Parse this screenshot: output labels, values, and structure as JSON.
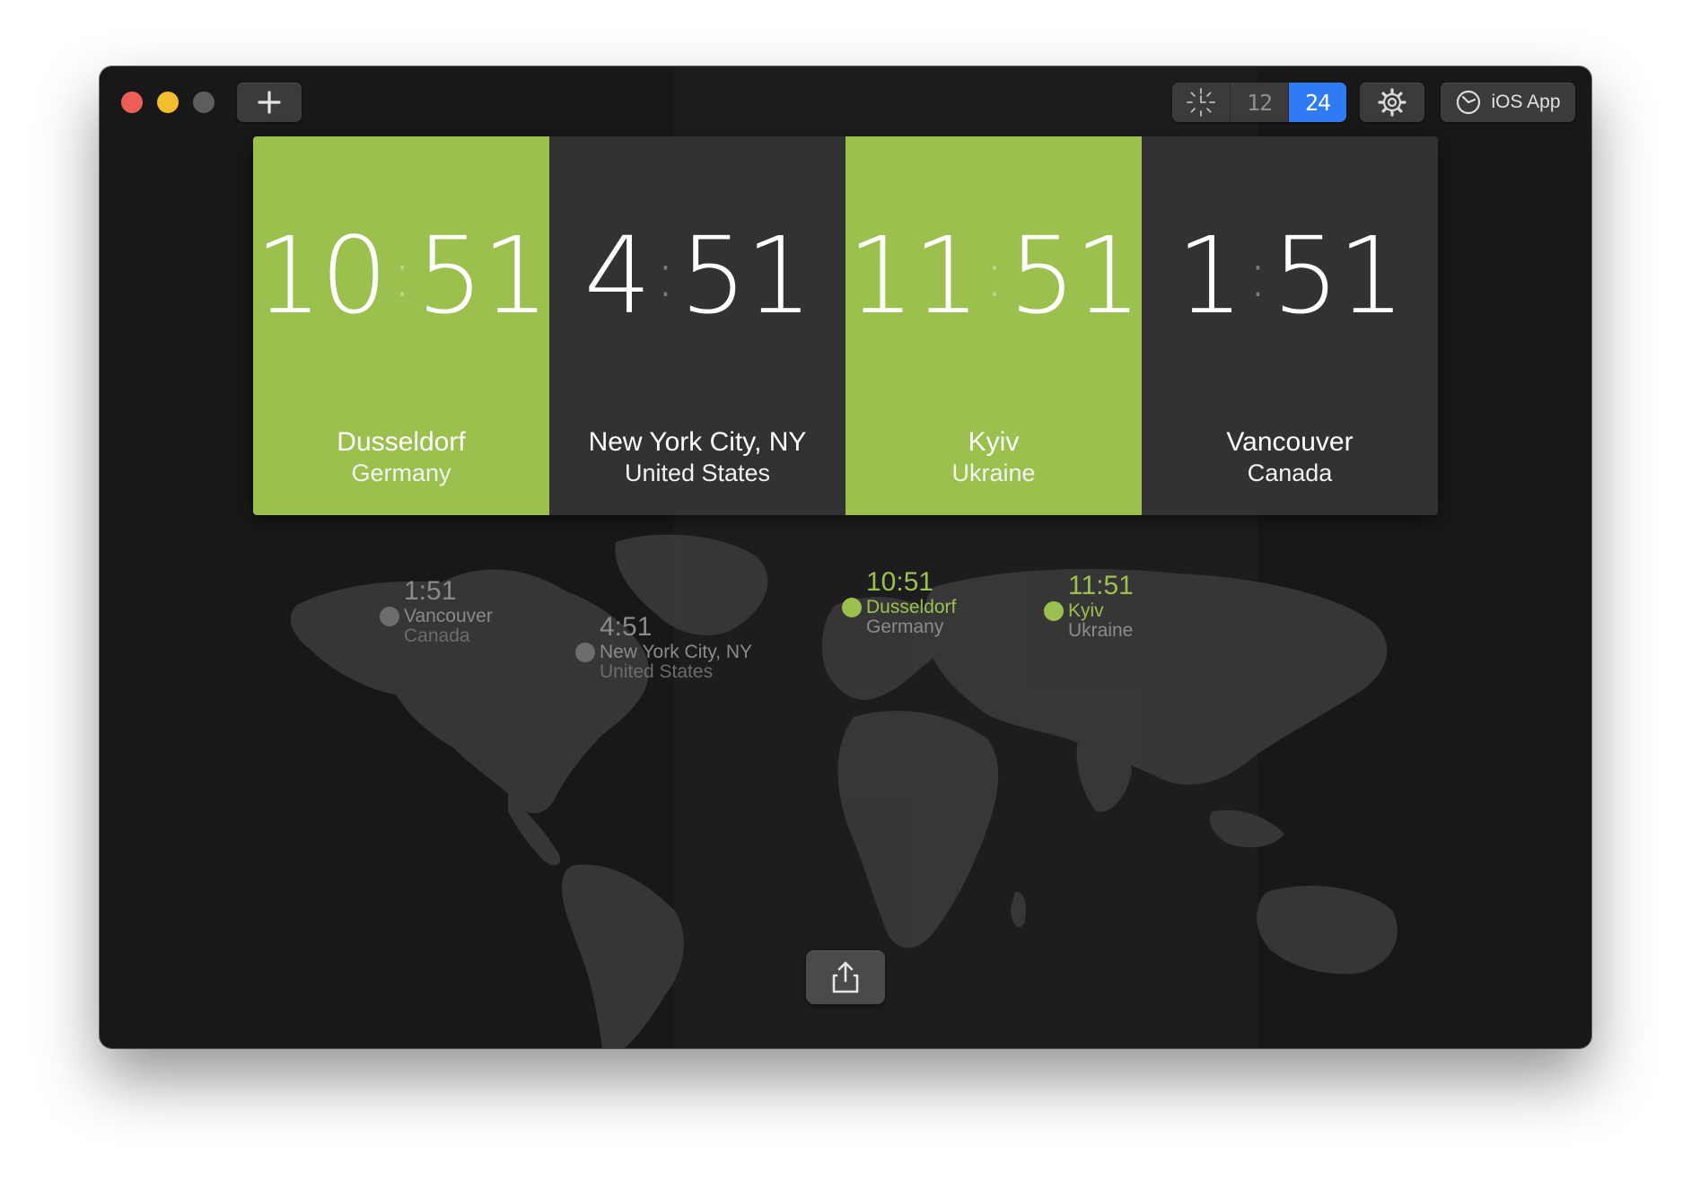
{
  "toolbar": {
    "add_icon": "plus-icon",
    "format_toggle": [
      {
        "id": "analog",
        "icon": "analog-clock-icon"
      },
      {
        "id": "12h",
        "label": "12"
      },
      {
        "id": "24h",
        "label": "24",
        "active": true
      }
    ],
    "settings_icon": "gear-icon",
    "ios_app_label": "iOS App",
    "ios_app_icon": "clock-outline-icon"
  },
  "clocks": [
    {
      "hours": "10",
      "minutes": "51",
      "city": "Dusseldorf",
      "country": "Germany",
      "color": "#9cc04e"
    },
    {
      "hours": "4",
      "minutes": "51",
      "city": "New York City, NY",
      "country": "United States",
      "color": "#323232"
    },
    {
      "hours": "11",
      "minutes": "51",
      "city": "Kyiv",
      "country": "Ukraine",
      "color": "#9cc04e"
    },
    {
      "hours": "1",
      "minutes": "51",
      "city": "Vancouver",
      "country": "Canada",
      "color": "#323232"
    }
  ],
  "map_markers": [
    {
      "time": "1:51",
      "city": "Vancouver",
      "country": "Canada",
      "status": "night"
    },
    {
      "time": "4:51",
      "city": "New York City, NY",
      "country": "United States",
      "status": "night"
    },
    {
      "time": "10:51",
      "city": "Dusseldorf",
      "country": "Germany",
      "status": "day"
    },
    {
      "time": "11:51",
      "city": "Kyiv",
      "country": "Ukraine",
      "status": "day"
    }
  ],
  "share_icon": "share-icon",
  "colors": {
    "accent_green": "#9cc04e",
    "accent_blue": "#2f7bf6",
    "window_bg": "#1d1d1d",
    "card_dark": "#323232"
  }
}
